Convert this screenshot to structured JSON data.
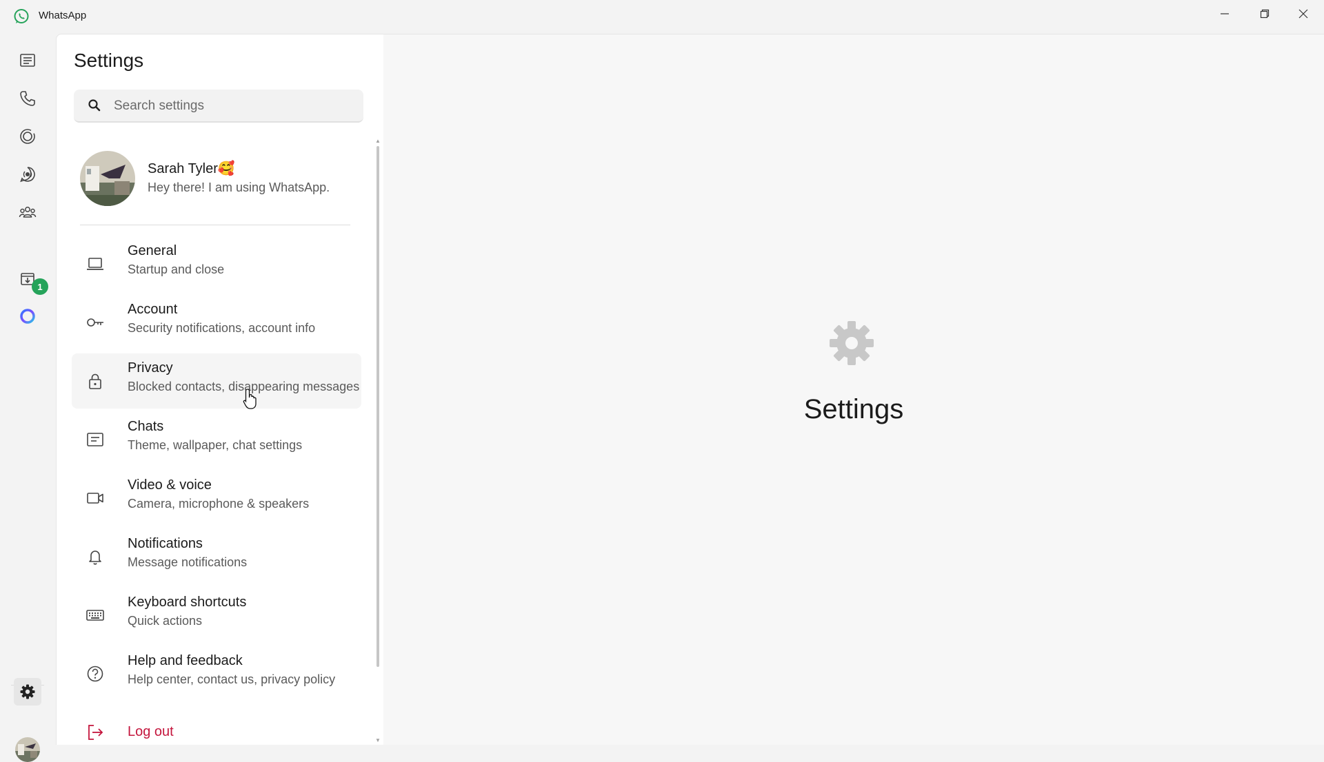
{
  "window": {
    "title": "WhatsApp",
    "controls": [
      "minimize-icon",
      "restore-icon",
      "close-icon"
    ]
  },
  "rail": {
    "items": [
      "chats-icon",
      "calls-icon",
      "status-icon",
      "channels-icon",
      "communities-icon",
      "archived-icon",
      "meta-ai-icon"
    ],
    "archived_badge": "1",
    "bottom": [
      "settings-icon",
      "profile-avatar"
    ]
  },
  "settings": {
    "title": "Settings",
    "search_placeholder": "Search settings",
    "profile": {
      "name": "Sarah Tyler🥰",
      "status": "Hey there! I am using WhatsApp."
    },
    "items": [
      {
        "label": "General",
        "sub": "Startup and close",
        "icon": "laptop-icon"
      },
      {
        "label": "Account",
        "sub": "Security notifications, account info",
        "icon": "key-icon"
      },
      {
        "label": "Privacy",
        "sub": "Blocked contacts, disappearing messages",
        "icon": "lock-icon"
      },
      {
        "label": "Chats",
        "sub": "Theme, wallpaper, chat settings",
        "icon": "chat-icon"
      },
      {
        "label": "Video & voice",
        "sub": "Camera, microphone & speakers",
        "icon": "video-icon"
      },
      {
        "label": "Notifications",
        "sub": "Message notifications",
        "icon": "bell-icon"
      },
      {
        "label": "Keyboard shortcuts",
        "sub": "Quick actions",
        "icon": "keyboard-icon"
      },
      {
        "label": "Help and feedback",
        "sub": "Help center, contact us, privacy policy",
        "icon": "help-icon"
      }
    ],
    "logout": "Log out"
  },
  "main": {
    "title": "Settings",
    "icon": "gear-icon"
  },
  "colors": {
    "accent_green": "#25a35a",
    "logout_red": "#c4163d",
    "background": "#f3f3f3",
    "panel": "#ffffff"
  }
}
